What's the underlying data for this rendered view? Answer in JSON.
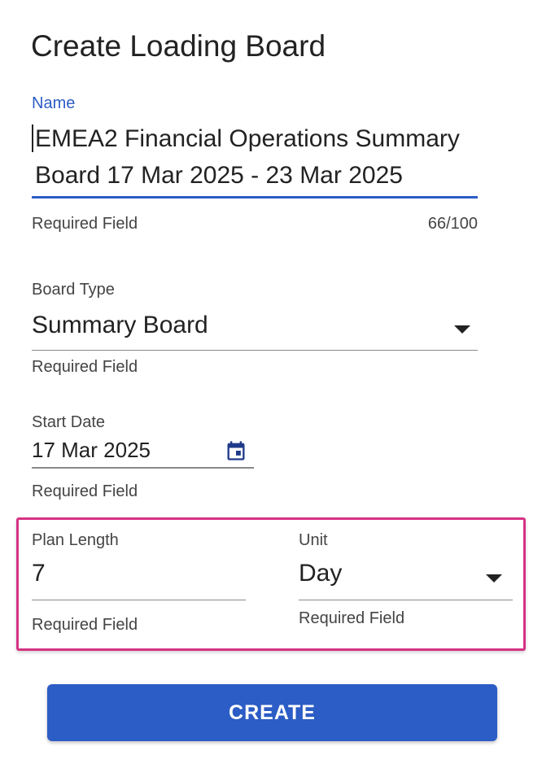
{
  "title": "Create Loading Board",
  "name_field": {
    "label": "Name",
    "value": "EMEA2 Financial Operations Summary Board 17 Mar 2025 - 23 Mar 2025",
    "helper": "Required Field",
    "counter": "66/100"
  },
  "board_type": {
    "label": "Board Type",
    "value": "Summary Board",
    "helper": "Required Field",
    "icon": "chevron-down-icon"
  },
  "start_date": {
    "label": "Start Date",
    "value": "17 Mar 2025",
    "helper": "Required Field",
    "icon": "calendar-icon"
  },
  "plan_length": {
    "label": "Plan Length",
    "value": "7",
    "helper": "Required Field"
  },
  "unit": {
    "label": "Unit",
    "value": "Day",
    "helper": "Required Field",
    "icon": "chevron-down-icon"
  },
  "create_button": {
    "label": "CREATE"
  },
  "colors": {
    "accent": "#2c5cc5",
    "highlight_border": "#d63384",
    "text": "#222222",
    "helper_text": "#444444"
  }
}
